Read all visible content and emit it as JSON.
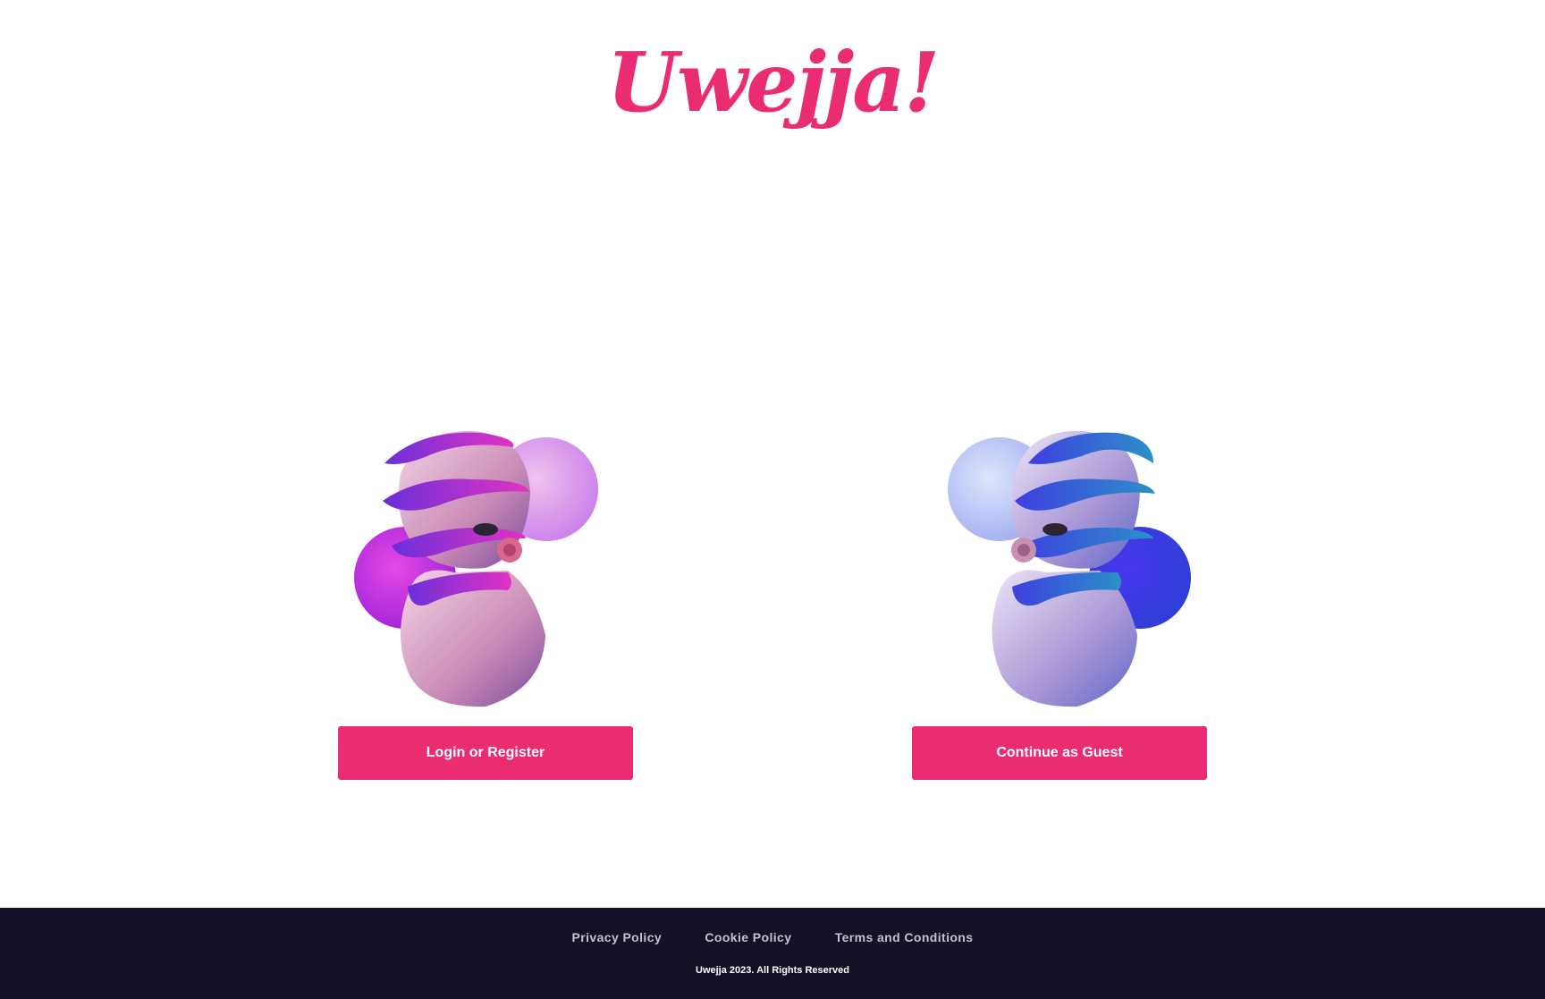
{
  "header": {
    "logo_text": "Uwejja!"
  },
  "main": {
    "login_button": "Login or Register",
    "guest_button": "Continue as Guest"
  },
  "footer": {
    "links": [
      "Privacy Policy",
      "Cookie Policy",
      "Terms and Conditions"
    ],
    "copyright": "Uwejja 2023. All Rights Reserved"
  },
  "colors": {
    "brand_pink": "#ea2c72",
    "footer_bg": "#141026"
  },
  "icons": {
    "left_art": "bust-sculpture-pink",
    "right_art": "bust-sculpture-blue"
  }
}
